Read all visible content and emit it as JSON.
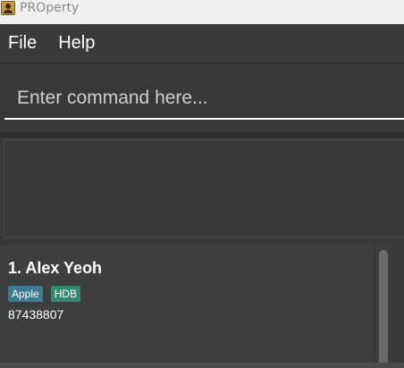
{
  "window": {
    "title": "PROperty",
    "icon": "person-icon"
  },
  "menu": {
    "items": [
      "File",
      "Help"
    ]
  },
  "command": {
    "placeholder": "Enter command here..."
  },
  "result_display": {
    "text": ""
  },
  "person_list": [
    {
      "index_name": "1. Alex Yeoh",
      "tags": [
        "Apple",
        "HDB"
      ],
      "phone": "87438807"
    }
  ],
  "colors": {
    "titlebar_bg": "#f0f0f0",
    "app_bg": "#383838",
    "card_bg": "#3c3e3f",
    "tag_apple": "#3e7b91",
    "tag_hdb": "#2f8a6e",
    "text": "#ffffff"
  }
}
